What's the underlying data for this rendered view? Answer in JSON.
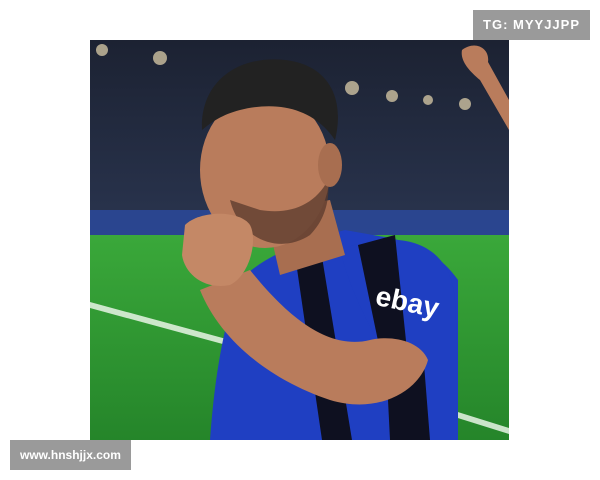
{
  "photo": {
    "subject": "footballer-kissing-fist",
    "shirt_sponsor": "ebay",
    "colors": {
      "kit_blue": "#1f3fc2",
      "kit_black": "#0e1020",
      "pitch": "#2f9a2c",
      "skin": "#b97c5c"
    }
  },
  "watermark_top": {
    "text": "TG: MYYJJPP"
  },
  "watermark_bottom": {
    "text": "www.hnshjjx.com"
  }
}
